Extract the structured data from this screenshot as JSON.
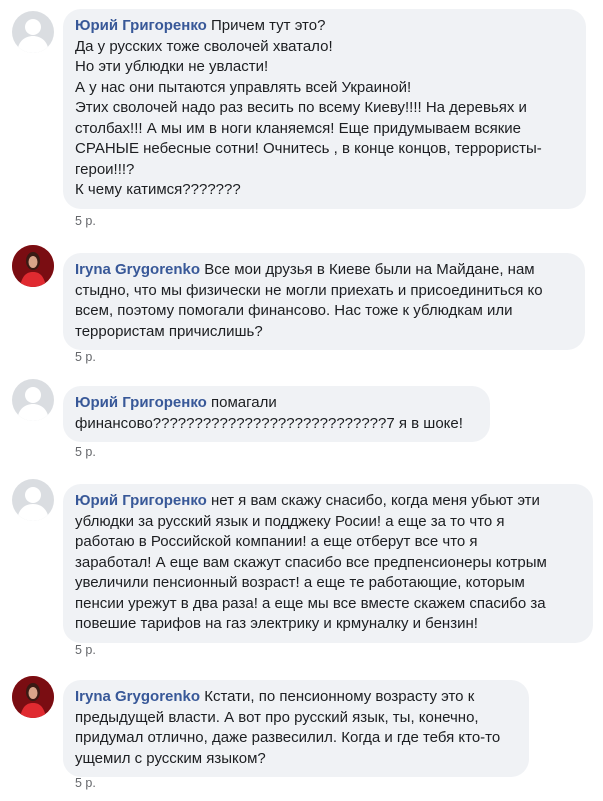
{
  "comments": [
    {
      "author": "Юрий Григоренко",
      "lines": [
        "Причем тут это?",
        "Да у русских тоже сволочей хватало!",
        "Но эти ублюдки не увласти!",
        "А у нас они пытаются управлять всей Украиной!",
        "Этих сволочей надо раз весить по всему Киеву!!!! На деревьях и",
        "столбах!!! А мы им в ноги кланяемся! Еще придумываем всякие",
        "СРАНЫЕ небесные сотни! Очнитесь , в конце концов, террористы-",
        "герои!!!?",
        "К чему катимся???????"
      ],
      "time": "5 р.",
      "avatar_icon": "default-profile-icon"
    },
    {
      "author": "Iryna Grygorenko",
      "lines": [
        "Все мои друзья в Киеве были на Майдане, нам",
        "стыдно, что мы физически не могли приехать и присоединиться ко",
        "всем, поэтому помогали финансово. Нас тоже к ублюдкам или",
        "террористам причислишь?"
      ],
      "time": "5 р.",
      "avatar_icon": "profile-photo-icon"
    },
    {
      "author": "Юрий Григоренко",
      "lines": [
        "помагали",
        "финансово????????????????????????????7 я в шоке!"
      ],
      "time": "5 р.",
      "avatar_icon": "default-profile-icon"
    },
    {
      "author": "Юрий Григоренко",
      "lines": [
        "нет я вам скажу снасибо, когда меня убьют эти",
        "ублюдки за русский язык и подджеку Росии! а еще за то что я",
        "работаю в Российской компании! а еще отберут все что я",
        "заработал! А еще вам скажут спасибо все предпенсионеры котрым",
        "увеличили пенсионный возраст! а еще те работающие, которым",
        "пенсии урежут в два раза! а еще мы все вместе скажем спасибо за",
        "повешие тарифов на газ электрику и крмуналку и бензин!"
      ],
      "time": "5 р.",
      "avatar_icon": "default-profile-icon"
    },
    {
      "author": "Iryna Grygorenko",
      "lines": [
        "Кстати, по пенсионному возрасту это к",
        "предыдущей власти. А вот про русский язык, ты, конечно,",
        "придумал отлично, даже развесилил. Когда и где тебя кто-то",
        "ущемил с русским языком?"
      ],
      "time": "5 р.",
      "avatar_icon": "profile-photo-icon"
    }
  ],
  "colors": {
    "bubble": "#f0f2f5",
    "author": "#385898",
    "meta": "#65676b",
    "avatar_default": "#dadde1",
    "avatar_photo": "#c21d24"
  }
}
